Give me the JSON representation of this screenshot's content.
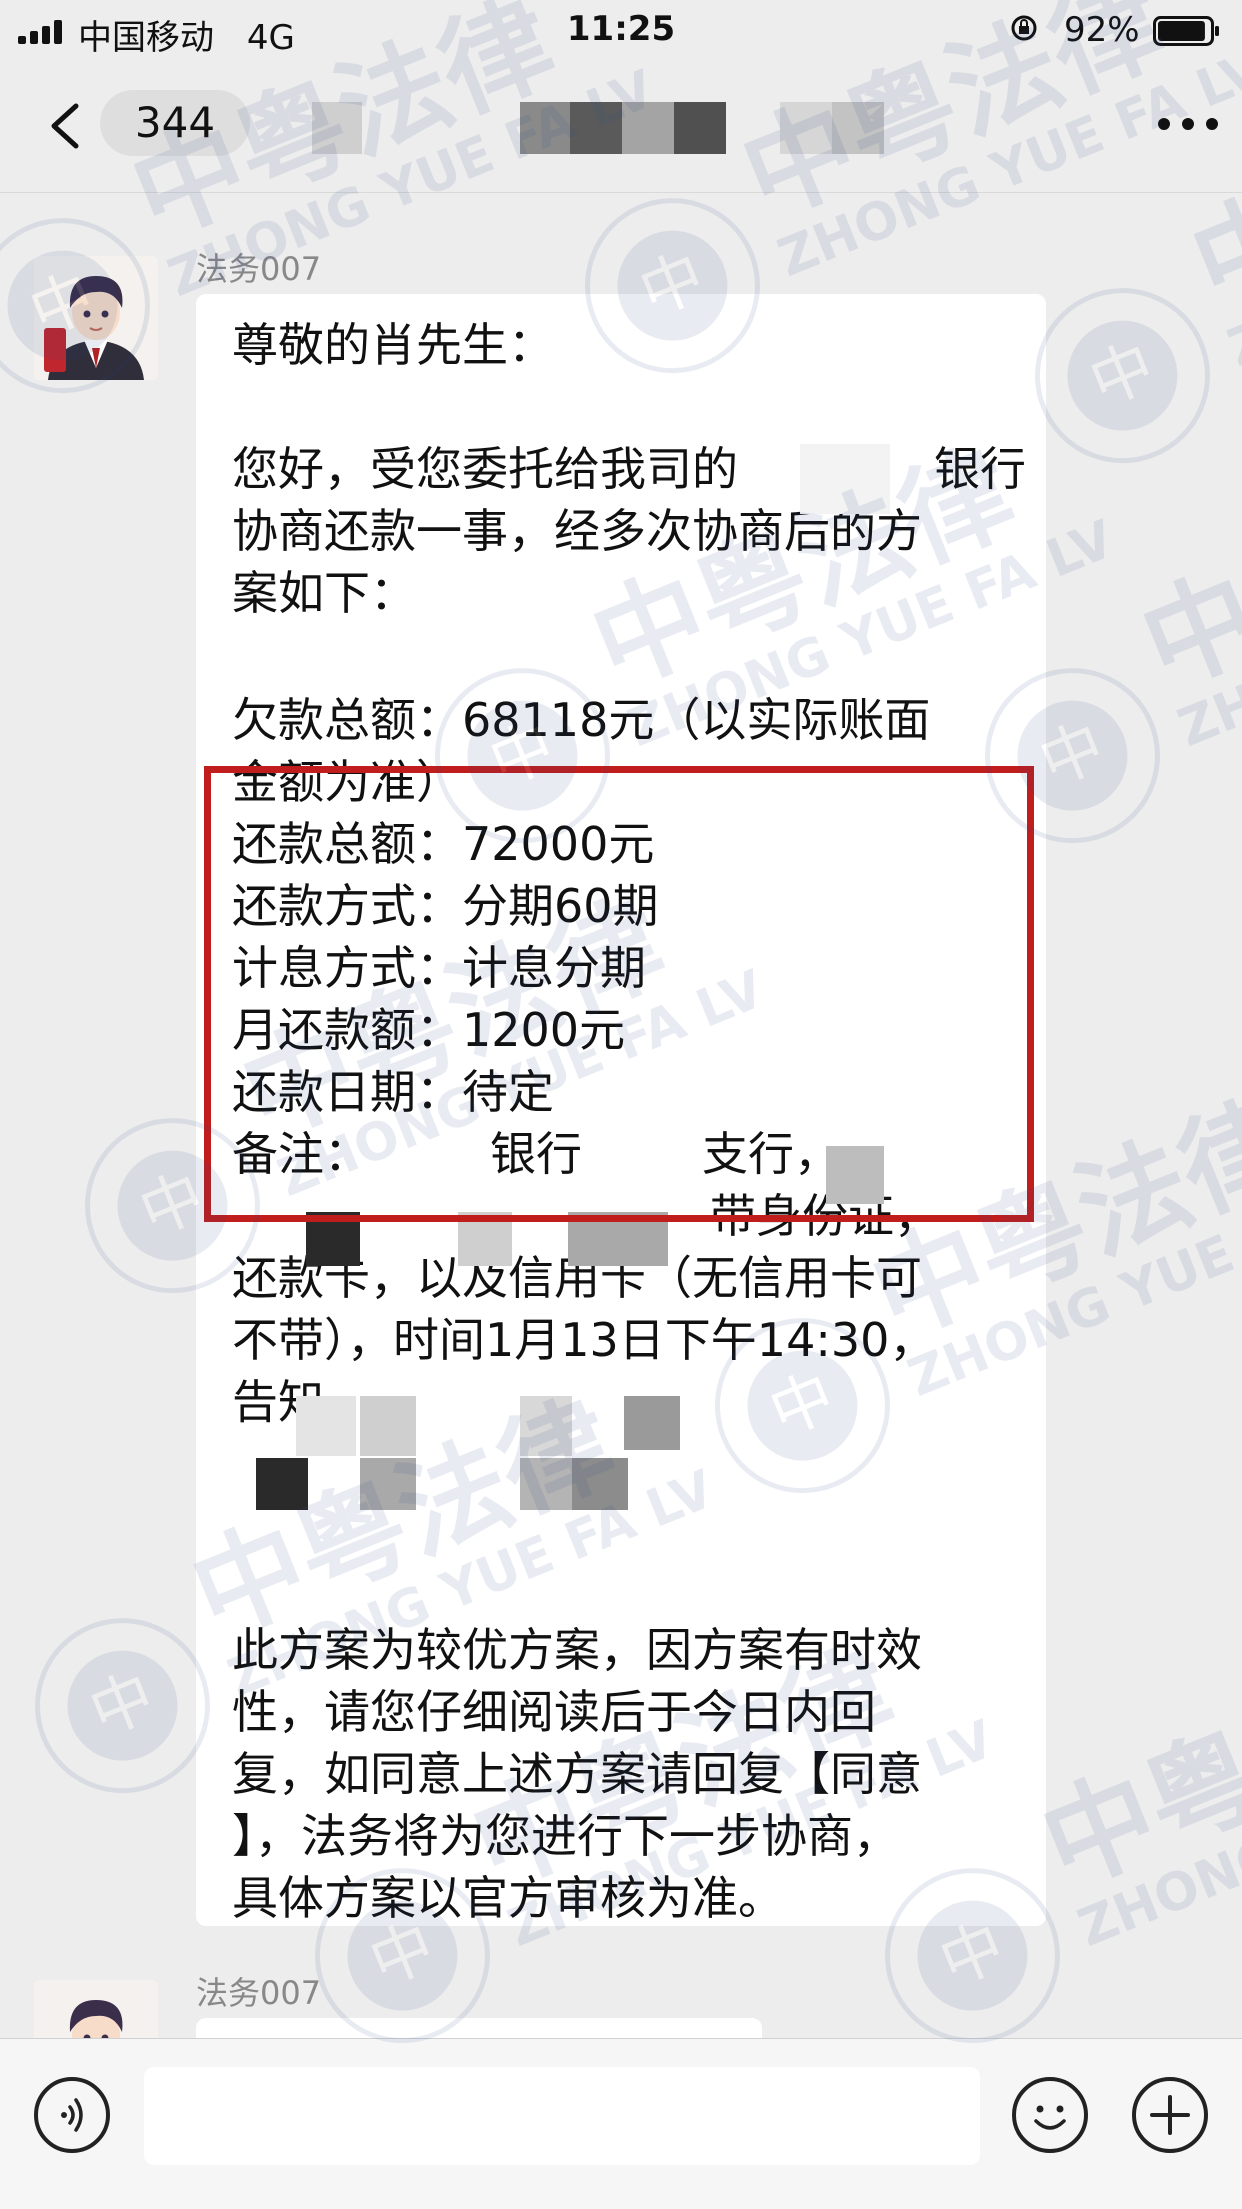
{
  "status_bar": {
    "carrier": "中国移动",
    "network": "4G",
    "time": "11:25",
    "battery": "92%",
    "battery_level": 0.92
  },
  "nav": {
    "unread_count": "344"
  },
  "messages": [
    {
      "sender": "法务007",
      "greeting": "尊敬的肖先生：",
      "intro_lines": [
        "您好，受您委托给我司的",
        "协商还款一事，经多次协商后的方",
        "案如下："
      ],
      "intro_bank_word": "银行",
      "plan_lines": [
        "欠款总额：68118元（以实际账面",
        "金额为准）",
        "还款总额：72000元",
        "还款方式：分期60期",
        "计息方式：计息分期",
        "月还款额：1200元",
        "还款日期：待定"
      ],
      "note": {
        "label": "备注：",
        "bank_word": "银行",
        "branch_word": "支行，",
        "line2": "带身份证，",
        "line3": "还款卡，以及信用卡（无信用卡可",
        "line4": "不带），时间1月13日下午14:30，",
        "line5": "告知"
      },
      "closing_lines": [
        "此方案为较优方案，因方案有时效",
        "性，请您仔细阅读后于今日内回",
        "复，如同意上述方案请回复【同意",
        "】，法务将为您进行下一步协商，",
        "具体方案以官方审核为准。"
      ]
    },
    {
      "sender": "法务007"
    }
  ],
  "watermark": {
    "cn": "中粤法律",
    "en": "ZHONG YUE FA LV",
    "seal_char": "中"
  },
  "icons": {
    "voice": "voice-icon",
    "emoji": "emoji-icon",
    "add": "plus-icon",
    "back": "chevron-left-icon",
    "more": "more-icon"
  }
}
